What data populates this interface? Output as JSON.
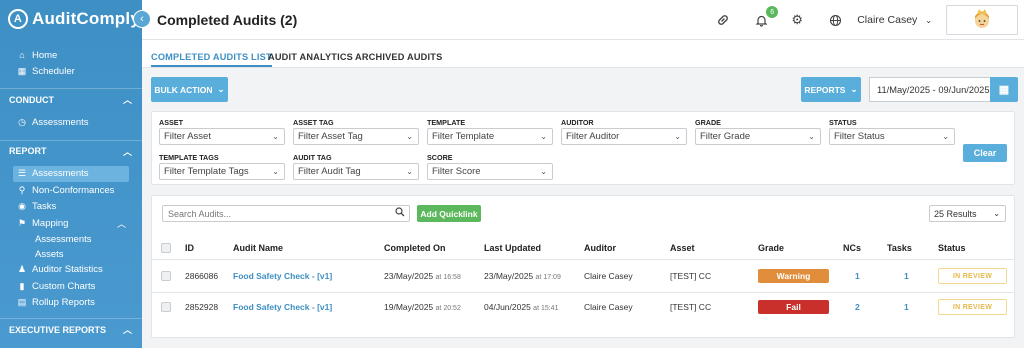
{
  "app": {
    "name": "AuditComply",
    "logo_mark": "A"
  },
  "sidebar": {
    "top_items": [
      {
        "label": "Home",
        "icon": "home-icon",
        "glyph": "⌂"
      },
      {
        "label": "Scheduler",
        "icon": "calendar-icon",
        "glyph": "▦"
      }
    ],
    "conduct": {
      "label": "CONDUCT",
      "items": [
        {
          "label": "Assessments",
          "icon": "clock-icon",
          "glyph": "◷"
        }
      ]
    },
    "report": {
      "label": "REPORT",
      "items": [
        {
          "label": "Assessments",
          "icon": "list-icon",
          "glyph": "☰",
          "active": true
        },
        {
          "label": "Non-Conformances",
          "icon": "search-user-icon",
          "glyph": "⚲"
        },
        {
          "label": "Tasks",
          "icon": "tasks-icon",
          "glyph": "◉"
        },
        {
          "label": "Mapping",
          "icon": "map-pin-icon",
          "glyph": "⚑"
        },
        {
          "label": "Auditor Statistics",
          "icon": "users-icon",
          "glyph": "♟"
        },
        {
          "label": "Custom Charts",
          "icon": "bar-chart-icon",
          "glyph": "▮"
        },
        {
          "label": "Rollup Reports",
          "icon": "report-icon",
          "glyph": "▤"
        }
      ],
      "mapping_sub": [
        "Assessments",
        "Assets"
      ]
    },
    "executive": {
      "label": "EXECUTIVE REPORTS"
    }
  },
  "header": {
    "title": "Completed Audits (2)",
    "user": "Claire Casey",
    "notification_count": "6"
  },
  "tabs": [
    "COMPLETED AUDITS LIST",
    "AUDIT ANALYTICS",
    "ARCHIVED AUDITS"
  ],
  "toolbar": {
    "bulk_action": "BULK ACTION",
    "reports": "REPORTS",
    "date_range": "11/May/2025 - 09/Jun/2025",
    "clear": "Clear"
  },
  "filters": {
    "asset": {
      "label": "ASSET",
      "placeholder": "Filter Asset"
    },
    "asset_tag": {
      "label": "ASSET TAG",
      "placeholder": "Filter Asset Tag"
    },
    "template": {
      "label": "TEMPLATE",
      "placeholder": "Filter Template"
    },
    "auditor": {
      "label": "AUDITOR",
      "placeholder": "Filter Auditor"
    },
    "grade": {
      "label": "GRADE",
      "placeholder": "Filter Grade"
    },
    "status": {
      "label": "STATUS",
      "placeholder": "Filter Status"
    },
    "template_tags": {
      "label": "TEMPLATE TAGS",
      "placeholder": "Filter Template Tags"
    },
    "audit_tag": {
      "label": "AUDIT TAG",
      "placeholder": "Filter Audit Tag"
    },
    "score": {
      "label": "SCORE",
      "placeholder": "Filter Score"
    }
  },
  "table": {
    "search_placeholder": "Search Audits...",
    "add_quicklink": "Add Quicklink",
    "results": "25 Results",
    "columns": [
      "ID",
      "Audit Name",
      "Completed On",
      "Last Updated",
      "Auditor",
      "Asset",
      "Grade",
      "NCs",
      "Tasks",
      "Status"
    ],
    "rows": [
      {
        "id": "2866086",
        "name": "Food Safety Check - [v1]",
        "completed_date": "23/May/2025",
        "completed_time": "at 16:58",
        "updated_date": "23/May/2025",
        "updated_time": "at 17:09",
        "auditor": "Claire Casey",
        "asset": "[TEST] CC",
        "grade": "Warning",
        "grade_color": "#e08d3c",
        "ncs": "1",
        "tasks": "1",
        "status": "IN REVIEW"
      },
      {
        "id": "2852928",
        "name": "Food Safety Check - [v1]",
        "completed_date": "19/May/2025",
        "completed_time": "at 20:52",
        "updated_date": "04/Jun/2025",
        "updated_time": "at 15:41",
        "auditor": "Claire Casey",
        "asset": "[TEST] CC",
        "grade": "Fail",
        "grade_color": "#c9302c",
        "ncs": "2",
        "tasks": "1",
        "status": "IN REVIEW"
      }
    ]
  }
}
